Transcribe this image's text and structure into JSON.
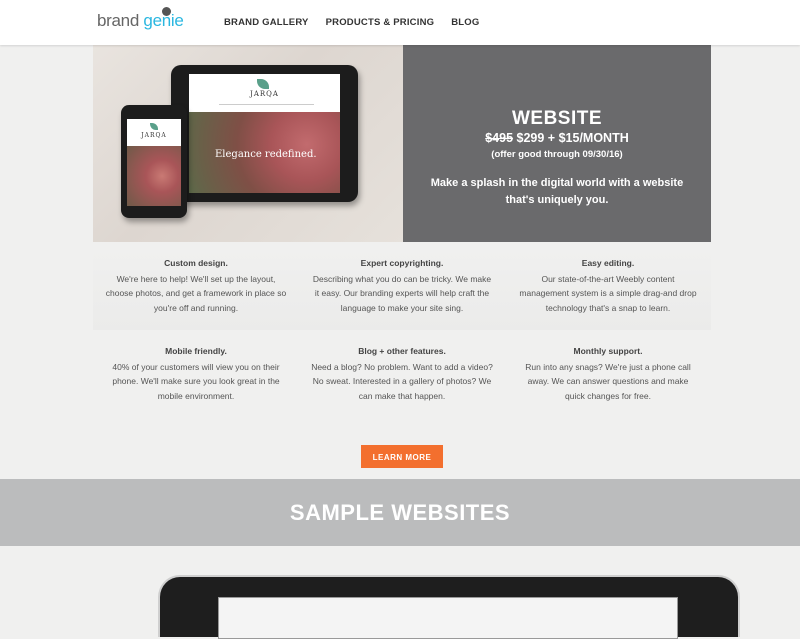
{
  "header": {
    "logo": {
      "brand": "brand",
      "genie": "genie"
    },
    "nav": [
      "BRAND GALLERY",
      "PRODUCTS & PRICING",
      "BLOG"
    ]
  },
  "hero": {
    "mockup": {
      "logo": "JARQA",
      "tagline": "Elegance redefined."
    },
    "title": "WEBSITE",
    "price_old": "$495",
    "price_new": "$299 + $15/MONTH",
    "offer": "(offer good through 09/30/16)",
    "description": "Make a splash in the digital world with a website that's uniquely you."
  },
  "features": [
    {
      "title": "Custom design.",
      "body": "We're here to help! We'll set up the layout, choose photos, and get a framework in place so you're off and running."
    },
    {
      "title": "Expert copyrighting.",
      "body": "Describing what you do can be tricky. We make it easy. Our branding experts will help craft the language to make your site sing."
    },
    {
      "title": "Easy editing.",
      "body": "Our state-of-the-art Weebly content management system is a simple drag-and drop technology that's a snap to learn."
    },
    {
      "title": "Mobile friendly.",
      "body": "40% of your customers will view you on their phone. We'll make sure you look great in the mobile environment."
    },
    {
      "title": "Blog + other features.",
      "body": "Need a blog? No problem. Want to add a video? No sweat. Interested in a gallery of photos? We can make that happen."
    },
    {
      "title": "Monthly support.",
      "body": "Run into any snags? We're just a phone call away. We can answer questions and make quick changes for free."
    }
  ],
  "cta": {
    "label": "LEARN MORE"
  },
  "samples": {
    "title": "SAMPLE WEBSITES"
  },
  "colors": {
    "accent": "#f36f2e",
    "logo_blue": "#2bb7e0",
    "panel_gray": "#6a6a6c",
    "band_gray": "#bbbcbd"
  }
}
